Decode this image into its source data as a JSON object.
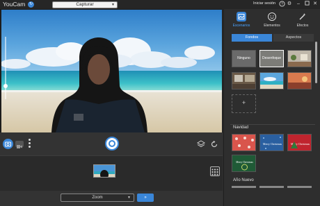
{
  "app": {
    "title": "YouCam"
  },
  "topbar": {
    "capture_select": "Capturar",
    "login_label": "Iniciar sesión"
  },
  "controls": {
    "zoom_select": "Zoom",
    "zoom_go_label": "»"
  },
  "panel": {
    "tabs": [
      {
        "label": "Escenarios",
        "active": true
      },
      {
        "label": "Elementos",
        "active": false
      },
      {
        "label": "Efectos",
        "active": false
      }
    ],
    "subtabs": {
      "active": "Fondos",
      "inactive": "Aspectos"
    },
    "backgrounds": [
      {
        "label": "Ninguno"
      },
      {
        "label": "Desenfoque"
      }
    ],
    "sections": [
      {
        "title": "Navidad"
      },
      {
        "title": "Año Nuevo"
      }
    ],
    "christmas_tiles": [
      {
        "label": ""
      },
      {
        "label": "Merry Christmas"
      },
      {
        "label": "Merry Christmas"
      },
      {
        "label": "Merry Christmas"
      },
      {
        "label": "Merry Christmas"
      }
    ]
  },
  "colors": {
    "accent": "#3a86d8",
    "panel_bg": "#2e2e2e",
    "app_bg": "#2f2f2f"
  }
}
